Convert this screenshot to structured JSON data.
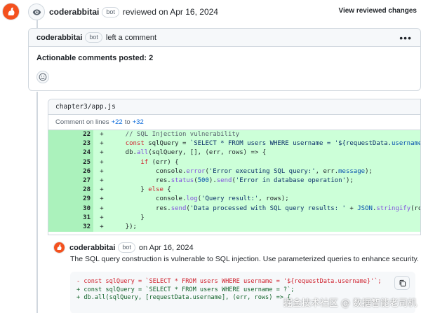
{
  "review": {
    "user": "coderabbitai",
    "bot_label": "bot",
    "action": "reviewed on Apr 16, 2024",
    "view_link": "View reviewed changes"
  },
  "comment": {
    "user": "coderabbitai",
    "bot_label": "bot",
    "action": "left a comment",
    "body": "Actionable comments posted: 2"
  },
  "file": {
    "path": "chapter3/app.js",
    "lines_prefix": "Comment on lines",
    "line_start": "+22",
    "lines_mid": "to",
    "line_end": "+32"
  },
  "diff_lines": [
    {
      "num": "22",
      "sign": "+"
    },
    {
      "num": "23",
      "sign": "+"
    },
    {
      "num": "24",
      "sign": "+"
    },
    {
      "num": "25",
      "sign": "+"
    },
    {
      "num": "26",
      "sign": "+"
    },
    {
      "num": "27",
      "sign": "+"
    },
    {
      "num": "28",
      "sign": "+"
    },
    {
      "num": "29",
      "sign": "+"
    },
    {
      "num": "30",
      "sign": "+"
    },
    {
      "num": "31",
      "sign": "+"
    },
    {
      "num": "32",
      "sign": "+"
    }
  ],
  "code": {
    "l22": "    // SQL Injection vulnerability",
    "l23a": "    ",
    "l23_const": "const",
    "l23b": " sqlQuery = ",
    "l23_str": "`SELECT * FROM users WHERE username = '${requestData.",
    "l23_prop": "username",
    "l23_end": "}'`",
    "l23_semi": ";",
    "l24a": "    db.",
    "l24_fn": "all",
    "l24b": "(sqlQuery, [], (err, rows) => {",
    "l25a": "        ",
    "l25_if": "if",
    "l25b": " (err) {",
    "l26a": "            console.",
    "l26_fn": "error",
    "l26b": "(",
    "l26_str": "'Error executing SQL query:'",
    "l26c": ", err.",
    "l26_prop": "message",
    "l26d": ");",
    "l27a": "            res.",
    "l27_fn1": "status",
    "l27b": "(",
    "l27_num": "500",
    "l27c": ").",
    "l27_fn2": "send",
    "l27d": "(",
    "l27_str": "'Error in database operation'",
    "l27e": ");",
    "l28a": "        } ",
    "l28_else": "else",
    "l28b": " {",
    "l29a": "            console.",
    "l29_fn": "log",
    "l29b": "(",
    "l29_str": "'Query result:'",
    "l29c": ", rows);",
    "l30a": "            res.",
    "l30_fn": "send",
    "l30b": "(",
    "l30_str": "'Data processed with SQL query results: '",
    "l30c": " + ",
    "l30_json": "JSON",
    "l30d": ".",
    "l30_fn2": "stringify",
    "l30e": "(rows));",
    "l31": "        }",
    "l32": "    });"
  },
  "reply": {
    "user": "coderabbitai",
    "bot_label": "bot",
    "date": "on Apr 16, 2024",
    "text": "The SQL query construction is vulnerable to SQL injection. Use parameterized queries to enhance security."
  },
  "suggestion": {
    "del1": "- const sqlQuery = `SELECT * FROM users WHERE username = '${requestData.username}'`;",
    "add1": "+ const sqlQuery = `SELECT * FROM users WHERE username = ?`;",
    "add2": "+ db.all(sqlQuery, [requestData.username], (err, rows) => {"
  },
  "watermark": "掘金技术社区 @ 数据智能老司机"
}
